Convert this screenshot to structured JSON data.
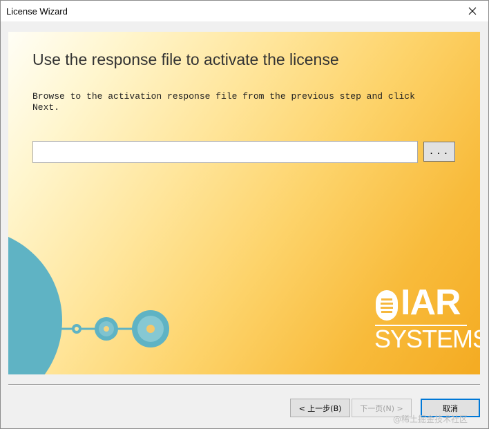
{
  "window": {
    "title": "License Wizard"
  },
  "content": {
    "heading": "Use the response file to activate the license",
    "instructions": "Browse to the activation response file from the previous step and click\nNext.",
    "file_path_value": "",
    "browse_label": "..."
  },
  "logo": {
    "line1": "IAR",
    "line2": "SYSTEMS"
  },
  "buttons": {
    "back": "< 上一步(B)",
    "next": "下一页(N) >",
    "cancel": "取消"
  },
  "watermark": "@稀土掘金技术社区",
  "colors": {
    "panel_light": "#fffef6",
    "panel_dark": "#f4ab22",
    "disc": "#5fb3c4",
    "button_focus_border": "#0078d7"
  },
  "icons": {
    "close": "close-icon",
    "logo_mark": "iar-logo-mark-icon"
  }
}
